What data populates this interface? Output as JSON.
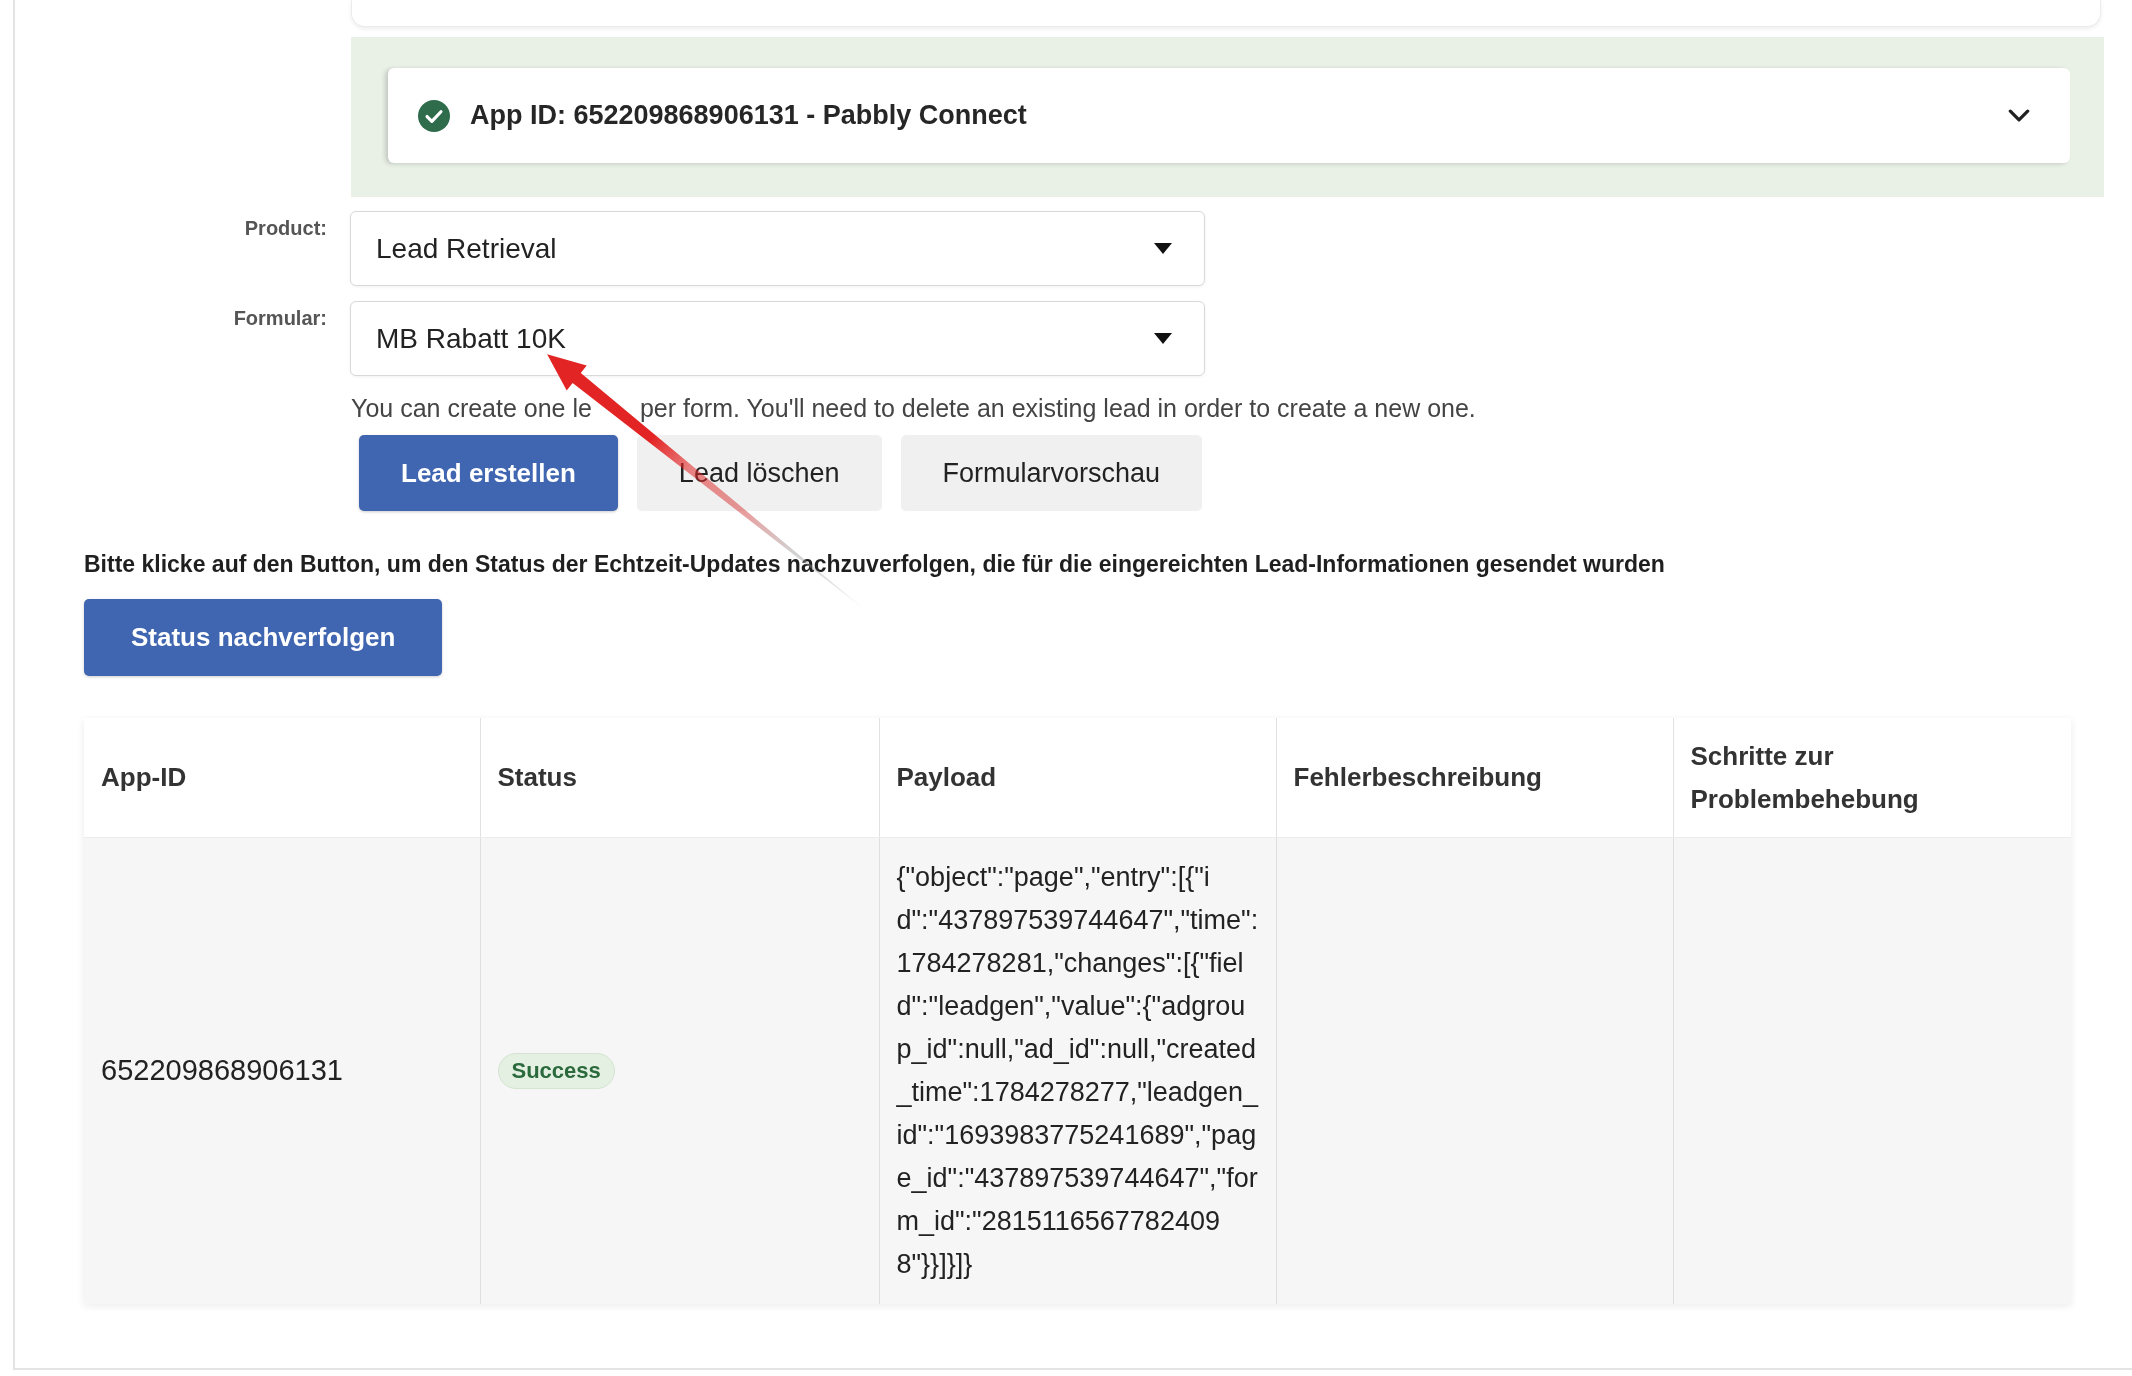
{
  "app_panel": {
    "title": "App ID: 652209868906131 - Pabbly Connect",
    "connected": true,
    "expanded": false
  },
  "form": {
    "fields": [
      {
        "label": "Product:",
        "value": "Lead Retrieval"
      },
      {
        "label": "Formular:",
        "value": "MB Rabatt 10K"
      }
    ],
    "hint_segments": [
      "You can create one le",
      "per form. You'll need to delete an existing lead in order to create a new one."
    ],
    "buttons": [
      {
        "label": "Lead erstellen",
        "kind": "primary"
      },
      {
        "label": "Lead löschen",
        "kind": "secondary"
      },
      {
        "label": "Formularvorschau",
        "kind": "secondary"
      }
    ]
  },
  "tracking": {
    "instruction": "Bitte klicke auf den Button, um den Status der Echtzeit-Updates nachzuverfolgen, die für die eingereichten Lead-Informationen gesendet wurden",
    "button": {
      "label": "Status nachverfolgen",
      "kind": "primary"
    }
  },
  "table": {
    "columns": [
      "App-ID",
      "Status",
      "Payload",
      "Fehlerbeschreibung",
      "Schritte zur Problembehebung"
    ],
    "rows": [
      {
        "app_id": "652209868906131",
        "status": {
          "label": "Success",
          "kind": "success"
        },
        "payload": "{\"object\":\"page\",\"entry\":[{\"id\":\"437897539744647\",\"time\":1784278281,\"changes\":[{\"field\":\"leadgen\",\"value\":{\"adgroup_id\":null,\"ad_id\":null,\"created_time\":1784278277,\"leadgen_id\":\"1693983775241689\",\"page_id\":\"437897539744647\",\"form_id\":\"28151165677824098\"}}]}]}"
      }
    ]
  }
}
